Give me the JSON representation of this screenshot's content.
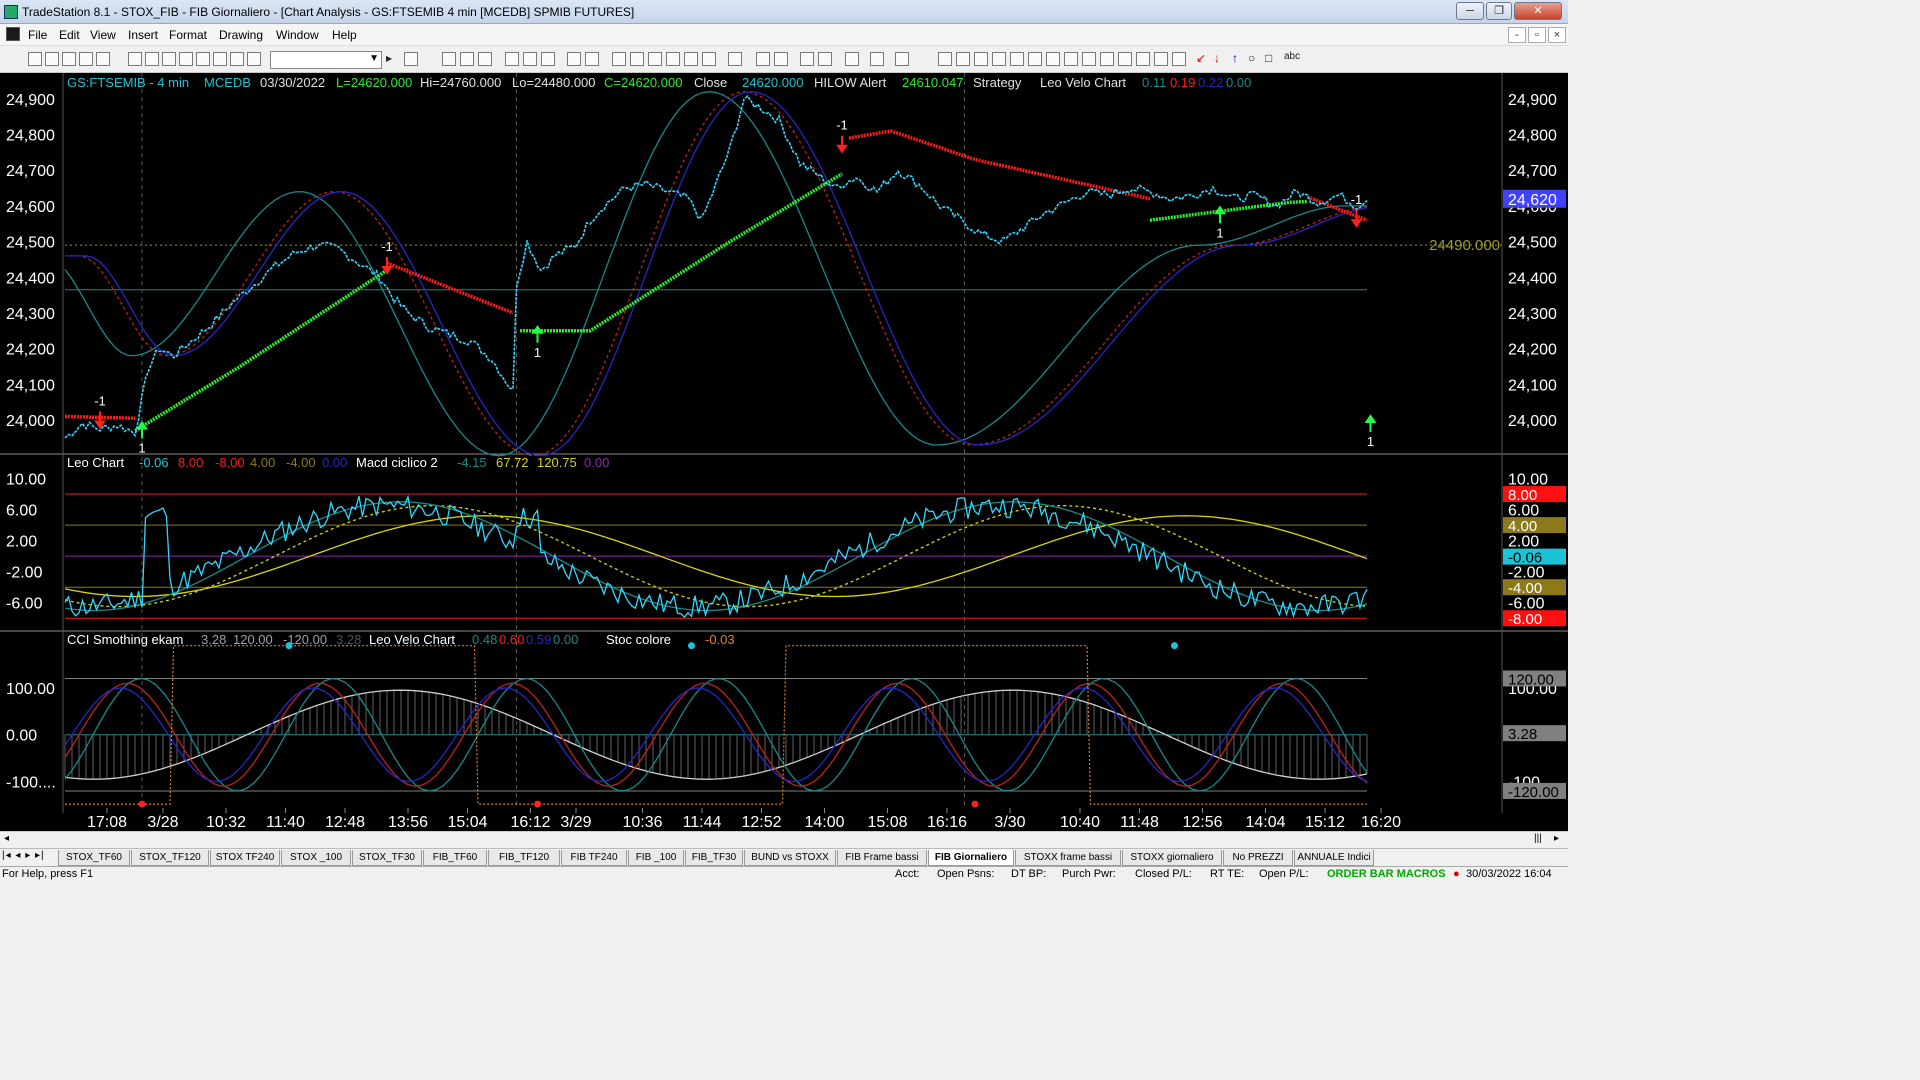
{
  "window": {
    "title": "TradeStation 8.1 - STOX_FIB - FIB Giornaliero - [Chart Analysis - GS:FTSEMIB  4 min  [MCEDB] SPMIB FUTURES]"
  },
  "menu": {
    "items": [
      "File",
      "Edit",
      "View",
      "Insert",
      "Format",
      "Drawing",
      "Window",
      "Help"
    ]
  },
  "toolbar": {
    "text_tool": "abc"
  },
  "chart_data": [
    {
      "type": "line",
      "name": "price-panel",
      "header": {
        "symbol": "GS:FTSEMIB - 4 min",
        "source": "MCEDB",
        "date": "03/30/2022",
        "last": "L=24620.000",
        "hi": "Hi=24760.000",
        "lo": "Lo=24480.000",
        "close_eq": "C=24620.000",
        "close_label": "Close",
        "close_val": "24620.000",
        "alert_label": "HILOW Alert",
        "alert_val": "24610.047",
        "strategy_label": "Strategy",
        "leo_label": "Leo Velo Chart",
        "leo_vals": [
          "0.11",
          "0.19",
          "0.22",
          "0.00"
        ]
      },
      "yticks": [
        "24,900",
        "24,800",
        "24,700",
        "24,600",
        "24,500",
        "24,400",
        "24,300",
        "24,200",
        "24,100",
        "24,000"
      ],
      "ytick_values": [
        24900,
        24800,
        24700,
        24600,
        24500,
        24400,
        24300,
        24200,
        24100,
        24000
      ],
      "ylim": [
        23930,
        24950
      ],
      "last_price_label": "24,620",
      "hline_label": "24490.000",
      "hline_value": 24490,
      "hline2_value": 24365,
      "signals": [
        {
          "text": "-1",
          "x": 10,
          "dir": "down"
        },
        {
          "text": "1",
          "x": 22,
          "dir": "up"
        },
        {
          "text": "-1",
          "x": 92,
          "dir": "down"
        },
        {
          "text": "1",
          "x": 135,
          "dir": "up"
        },
        {
          "text": "-1",
          "x": 222,
          "dir": "down"
        },
        {
          "text": "1",
          "x": 330,
          "dir": "up"
        },
        {
          "text": "-1",
          "x": 369,
          "dir": "down"
        },
        {
          "text": "1",
          "x": 373,
          "dir": "up"
        }
      ],
      "price_series": [
        [
          0,
          23950
        ],
        [
          5,
          23990
        ],
        [
          10,
          23975
        ],
        [
          15,
          23985
        ],
        [
          20,
          23965
        ],
        [
          22,
          24060
        ],
        [
          24,
          24150
        ],
        [
          27,
          24200
        ],
        [
          31,
          24180
        ],
        [
          36,
          24220
        ],
        [
          42,
          24270
        ],
        [
          48,
          24330
        ],
        [
          54,
          24380
        ],
        [
          60,
          24430
        ],
        [
          66,
          24470
        ],
        [
          72,
          24490
        ],
        [
          78,
          24480
        ],
        [
          84,
          24440
        ],
        [
          90,
          24400
        ],
        [
          94,
          24340
        ],
        [
          98,
          24300
        ],
        [
          104,
          24260
        ],
        [
          110,
          24240
        ],
        [
          116,
          24220
        ],
        [
          122,
          24170
        ],
        [
          128,
          24080
        ],
        [
          129,
          24380
        ],
        [
          132,
          24500
        ],
        [
          136,
          24420
        ],
        [
          140,
          24460
        ],
        [
          146,
          24490
        ],
        [
          150,
          24560
        ],
        [
          154,
          24600
        ],
        [
          160,
          24650
        ],
        [
          166,
          24660
        ],
        [
          172,
          24640
        ],
        [
          178,
          24620
        ],
        [
          182,
          24560
        ],
        [
          186,
          24660
        ],
        [
          190,
          24760
        ],
        [
          194,
          24900
        ],
        [
          198,
          24880
        ],
        [
          204,
          24840
        ],
        [
          210,
          24720
        ],
        [
          216,
          24680
        ],
        [
          220,
          24650
        ],
        [
          226,
          24680
        ],
        [
          232,
          24640
        ],
        [
          238,
          24700
        ],
        [
          244,
          24660
        ],
        [
          250,
          24600
        ],
        [
          256,
          24560
        ],
        [
          262,
          24520
        ],
        [
          268,
          24500
        ],
        [
          274,
          24540
        ],
        [
          280,
          24580
        ],
        [
          286,
          24610
        ],
        [
          292,
          24640
        ],
        [
          298,
          24630
        ],
        [
          304,
          24650
        ],
        [
          310,
          24640
        ],
        [
          316,
          24620
        ],
        [
          322,
          24630
        ],
        [
          328,
          24650
        ],
        [
          334,
          24620
        ],
        [
          340,
          24630
        ],
        [
          346,
          24600
        ],
        [
          352,
          24640
        ],
        [
          358,
          24610
        ],
        [
          364,
          24630
        ],
        [
          369,
          24600
        ],
        [
          372,
          24615
        ]
      ],
      "stop_red": [
        [
          0,
          24010
        ],
        [
          20,
          24005
        ],
        [
          92,
          24440
        ],
        [
          128,
          24300
        ],
        [
          224,
          24790
        ],
        [
          236,
          24810
        ],
        [
          260,
          24730
        ],
        [
          310,
          24620
        ],
        [
          355,
          24625
        ],
        [
          372,
          24560
        ]
      ],
      "stop_green": [
        [
          20,
          23970
        ],
        [
          50,
          24150
        ],
        [
          92,
          24420
        ],
        [
          130,
          24250
        ],
        [
          150,
          24250
        ],
        [
          190,
          24500
        ],
        [
          222,
          24690
        ],
        [
          310,
          24560
        ],
        [
          350,
          24610
        ],
        [
          372,
          24620
        ]
      ]
    },
    {
      "type": "line",
      "name": "leo-chart-panel",
      "header": {
        "label": "Leo Chart",
        "vals": [
          "-0.06",
          "8.00",
          "-8.00",
          "4.00",
          "-4.00",
          "0.00"
        ],
        "macd_label": "Macd ciclico 2",
        "macd_vals": [
          "-4.15",
          "67.72",
          "120.75",
          "0.00"
        ]
      },
      "yticks": [
        "10.00",
        "6.00",
        "2.00",
        "-2.00",
        "-6.00"
      ],
      "ytick_values": [
        10,
        6,
        2,
        -2,
        -6
      ],
      "ylim": [
        -9,
        12
      ],
      "right_labels": [
        {
          "text": "8.00",
          "value": 8,
          "color": "#ff1010"
        },
        {
          "text": "4.00",
          "value": 4,
          "color": "#8c7a1a"
        },
        {
          "text": "-0.06",
          "value": -0.06,
          "color": "#19c4d6"
        },
        {
          "text": "-4.00",
          "value": -4,
          "color": "#8c7a1a"
        },
        {
          "text": "-8.00",
          "value": -8,
          "color": "#ff1010"
        }
      ]
    },
    {
      "type": "line",
      "name": "cci-panel",
      "header": {
        "label": "CCI Smothing ekam",
        "vals": [
          "3.28",
          "120.00",
          "-120.00",
          "3.28"
        ],
        "leo_label": "Leo Velo Chart",
        "leo_vals": [
          "0.48",
          "0.60",
          "0.59",
          "0.00"
        ],
        "stoc_label": "Stoc colore",
        "stoc_val": "-0.03"
      },
      "yticks": [
        "100.00",
        "0.00",
        "-100...."
      ],
      "ytick_values": [
        100,
        0,
        -100
      ],
      "ylim": [
        -150,
        200
      ],
      "right_labels": [
        {
          "text": "120.00",
          "value": 120,
          "color": "#808080"
        },
        {
          "text": "3.28",
          "value": 3.28,
          "color": "#808080"
        },
        {
          "text": "-120.00",
          "value": -120,
          "color": "#808080"
        }
      ]
    }
  ],
  "xaxis": {
    "labels": [
      "17:08",
      "3/28",
      "10:32",
      "11:40",
      "12:48",
      "13:56",
      "15:04",
      "16:12",
      "3/29",
      "10:36",
      "11:44",
      "12:52",
      "14:00",
      "15:08",
      "16:16",
      "3/30",
      "10:40",
      "11:48",
      "12:56",
      "14:04",
      "15:12",
      "16:20"
    ]
  },
  "tabs": [
    "STOX_TF60",
    "STOX_TF120",
    "STOX TF240",
    "STOX _100",
    "STOX_TF30",
    "FIB_TF60",
    "FIB_TF120",
    "FIB TF240",
    "FIB _100",
    "FIB_TF30",
    "BUND vs STOXX",
    "FIB Frame bassi",
    "FIB Giornaliero",
    "STOXX frame bassi",
    "STOXX giornaliero",
    "No PREZZI",
    "ANNUALE Indici"
  ],
  "active_tab": "FIB Giornaliero",
  "status": {
    "help": "For Help, press F1",
    "acct": "Acct:",
    "open_psns": "Open Psns:",
    "dt_bp": "DT BP:",
    "purch_pwr": "Purch Pwr:",
    "closed_pl": "Closed P/L:",
    "rt_te": "RT TE:",
    "open_pl": "Open P/L:",
    "macros": "ORDER BAR  MACROS",
    "datetime": "30/03/2022 16:04"
  },
  "colors": {
    "price": "#2fd8ff",
    "stop_red": "#ff1a1a",
    "stop_green": "#2aee2a",
    "cyan_line": "#178a8a",
    "navy_line": "#2626c8",
    "gold": "#d8d800",
    "panel_bg": "#000000",
    "last_box": "#4040ff"
  }
}
